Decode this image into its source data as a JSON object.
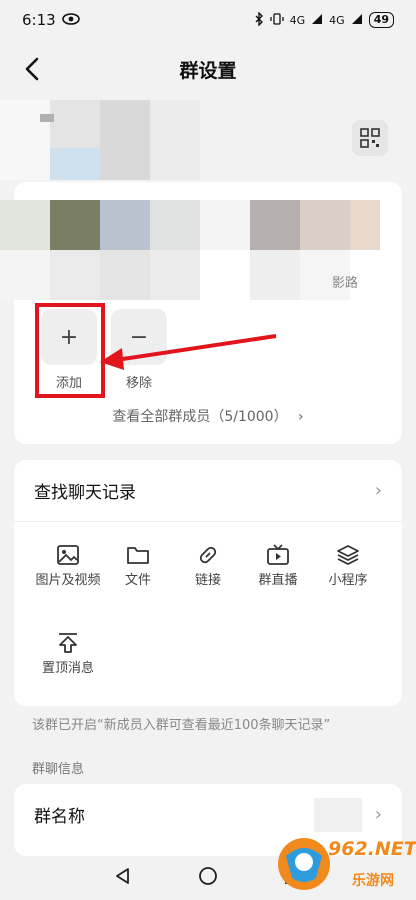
{
  "status_bar": {
    "time": "6:13",
    "battery": "49",
    "signal1": "4G",
    "signal2": "4G"
  },
  "nav": {
    "title": "群设置"
  },
  "members": {
    "visible_member_name": "影路",
    "add_label": "添加",
    "remove_label": "移除",
    "add_symbol": "+",
    "remove_symbol": "−",
    "view_all": "查看全部群成员（5/1000）"
  },
  "history": {
    "title": "查找聊天记录",
    "features": [
      {
        "label": "图片及视频",
        "icon": "image-icon"
      },
      {
        "label": "文件",
        "icon": "folder-icon"
      },
      {
        "label": "链接",
        "icon": "link-icon"
      },
      {
        "label": "群直播",
        "icon": "live-tv-icon"
      },
      {
        "label": "小程序",
        "icon": "layers-icon"
      },
      {
        "label": "置顶消息",
        "icon": "pin-top-icon"
      }
    ]
  },
  "notice": "该群已开启“新成员入群可查看最近100条聊天记录”",
  "group_info": {
    "section_title": "群聊信息",
    "name_label": "群名称"
  },
  "watermark": {
    "text_top": "962.NET",
    "text_bottom": "乐游网"
  },
  "colors": {
    "highlight": "#e2141c",
    "arrow": "#e2141c",
    "watermark_orange": "#f08a1c"
  }
}
